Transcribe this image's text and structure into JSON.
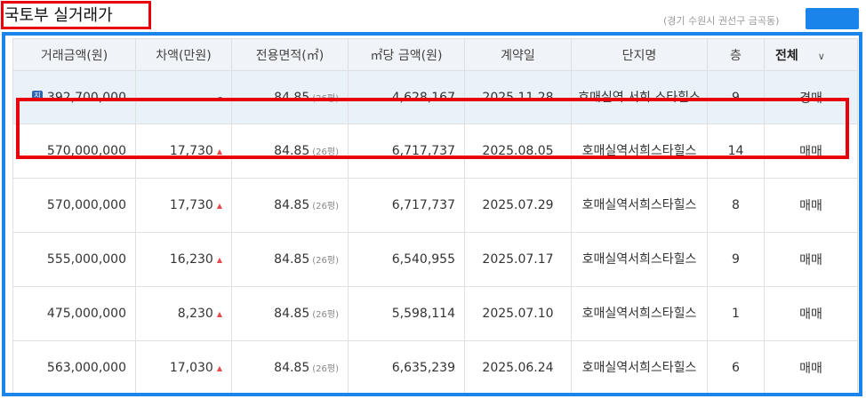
{
  "title": "국토부 실거래가",
  "location": "(경기 수원시 권선구 금곡동)",
  "columns": [
    "거래금액(원)",
    "차액(만원)",
    "전용면적(㎡)",
    "㎡당 금액(원)",
    "계약일",
    "단지명",
    "층"
  ],
  "filter": {
    "label": "전체",
    "chevron_icon": "chevron-down-icon"
  },
  "badge_text": "지",
  "rows": [
    {
      "price": "392,700,000",
      "diff": "-",
      "area": "84.85",
      "pyeong": "(26평)",
      "per_m2": "4,628,167",
      "date": "2025.11.28",
      "complex": "호매실역 서희 스타힐스",
      "floor": "9",
      "type": "경매"
    },
    {
      "price": "570,000,000",
      "diff": "17,730",
      "area": "84.85",
      "pyeong": "(26평)",
      "per_m2": "6,717,737",
      "date": "2025.08.05",
      "complex": "호매실역서희스타힐스",
      "floor": "14",
      "type": "매매"
    },
    {
      "price": "570,000,000",
      "diff": "17,730",
      "area": "84.85",
      "pyeong": "(26평)",
      "per_m2": "6,717,737",
      "date": "2025.07.29",
      "complex": "호매실역서희스타힐스",
      "floor": "8",
      "type": "매매"
    },
    {
      "price": "555,000,000",
      "diff": "16,230",
      "area": "84.85",
      "pyeong": "(26평)",
      "per_m2": "6,540,955",
      "date": "2025.07.17",
      "complex": "호매실역서희스타힐스",
      "floor": "9",
      "type": "매매"
    },
    {
      "price": "475,000,000",
      "diff": "8,230",
      "area": "84.85",
      "pyeong": "(26평)",
      "per_m2": "5,598,114",
      "date": "2025.07.10",
      "complex": "호매실역서희스타힐스",
      "floor": "1",
      "type": "매매"
    },
    {
      "price": "563,000,000",
      "diff": "17,030",
      "area": "84.85",
      "pyeong": "(26평)",
      "per_m2": "6,635,239",
      "date": "2025.06.24",
      "complex": "호매실역서희스타힐스",
      "floor": "6",
      "type": "매매"
    }
  ],
  "colors": {
    "accent_blue": "#1b84ea",
    "highlight_red": "#e8000b",
    "up_arrow": "#e64b4b"
  }
}
